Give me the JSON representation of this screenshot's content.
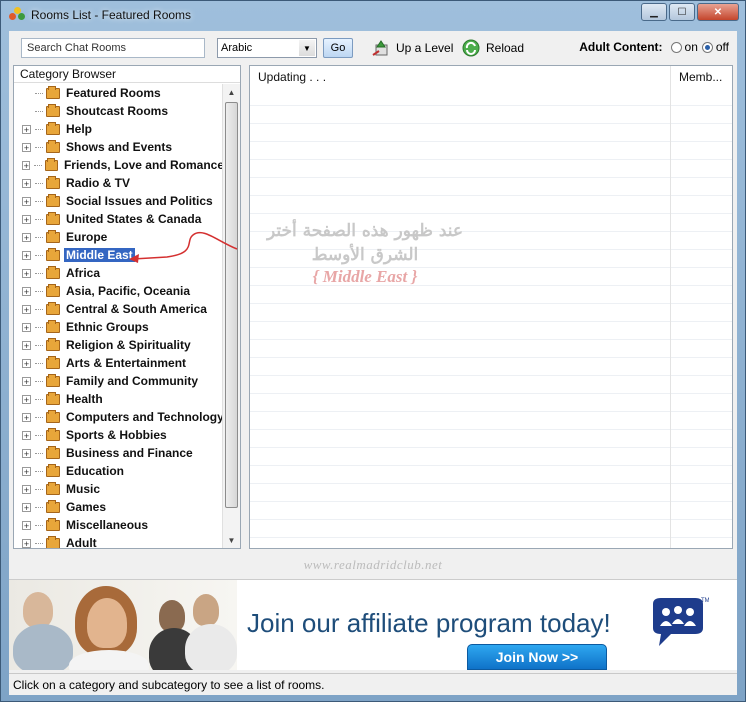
{
  "window": {
    "title": "Rooms List - Featured Rooms"
  },
  "toolbar": {
    "search_placeholder": "Search Chat Rooms",
    "language_selected": "Arabic",
    "go_label": "Go",
    "up_level_label": "Up a Level",
    "reload_label": "Reload",
    "adult_label": "Adult Content:",
    "adult_on_label": "on",
    "adult_off_label": "off",
    "adult_value": "off"
  },
  "category_browser": {
    "header": "Category Browser",
    "items": [
      {
        "label": "Featured Rooms",
        "expandable": false
      },
      {
        "label": "Shoutcast Rooms",
        "expandable": false
      },
      {
        "label": "Help",
        "expandable": true
      },
      {
        "label": "Shows and Events",
        "expandable": true
      },
      {
        "label": "Friends, Love and Romance",
        "expandable": true
      },
      {
        "label": "Radio & TV",
        "expandable": true
      },
      {
        "label": "Social Issues and Politics",
        "expandable": true
      },
      {
        "label": "United States & Canada",
        "expandable": true
      },
      {
        "label": "Europe",
        "expandable": true
      },
      {
        "label": "Middle East",
        "expandable": true,
        "selected": true
      },
      {
        "label": "Africa",
        "expandable": true
      },
      {
        "label": "Asia, Pacific, Oceania",
        "expandable": true
      },
      {
        "label": "Central & South America",
        "expandable": true
      },
      {
        "label": "Ethnic Groups",
        "expandable": true
      },
      {
        "label": "Religion & Spirituality",
        "expandable": true
      },
      {
        "label": "Arts & Entertainment",
        "expandable": true
      },
      {
        "label": "Family and Community",
        "expandable": true
      },
      {
        "label": "Health",
        "expandable": true
      },
      {
        "label": "Computers and Technology",
        "expandable": true
      },
      {
        "label": "Sports & Hobbies",
        "expandable": true
      },
      {
        "label": "Business and Finance",
        "expandable": true
      },
      {
        "label": "Education",
        "expandable": true
      },
      {
        "label": "Music",
        "expandable": true
      },
      {
        "label": "Games",
        "expandable": true
      },
      {
        "label": "Miscellaneous",
        "expandable": true
      },
      {
        "label": "Adult",
        "expandable": true
      }
    ]
  },
  "rooms_list": {
    "name_header": "Updating . . .",
    "members_header": "Memb..."
  },
  "annotation": {
    "line1": "عند ظهور هذه الصفحة أختر",
    "line2": "الشرق الأوسط",
    "line3": "{ Middle East }"
  },
  "watermark": "www.realmadridclub.net",
  "ad": {
    "headline": "Join our affiliate program today!",
    "button": "Join Now >>",
    "logo_mark": "TM"
  },
  "status": {
    "text": "Click on a category and subcategory to see a list of rooms."
  },
  "colors": {
    "selection": "#3466c2",
    "folder": "#e8a63a",
    "ad_text": "#1e4d7a",
    "ad_button": "#1a8ae0"
  }
}
